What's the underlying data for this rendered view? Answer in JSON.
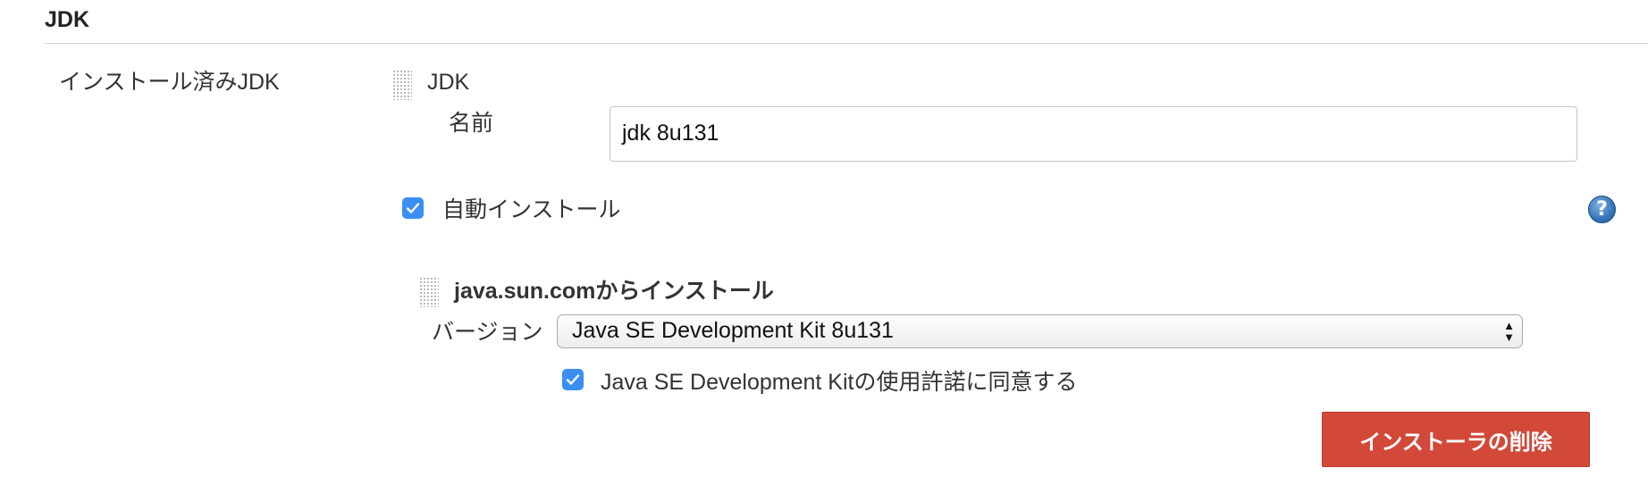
{
  "section": {
    "title": "JDK"
  },
  "installations": {
    "label": "インストール済みJDK",
    "jdk": {
      "header": "JDK",
      "name_label": "名前",
      "name_value": "jdk 8u131",
      "auto_install_label": "自動インストール",
      "auto_install_checked": true,
      "help_glyph": "?",
      "installer": {
        "header": "java.sun.comからインストール",
        "version_label": "バージョン",
        "version_value": "Java SE Development Kit 8u131",
        "license_label": "Java SE Development Kitの使用許諾に同意する",
        "license_checked": true,
        "delete_button_label": "インストーラの削除"
      }
    }
  },
  "colors": {
    "checkbox": "#3b8ff2",
    "delete_button": "#d24939",
    "help_icon": "#3573b8"
  },
  "icons": {
    "drag_handle": "grip-icon",
    "help": "help-icon",
    "checkbox": "checkmark-icon",
    "select": "updown-arrows-icon"
  }
}
